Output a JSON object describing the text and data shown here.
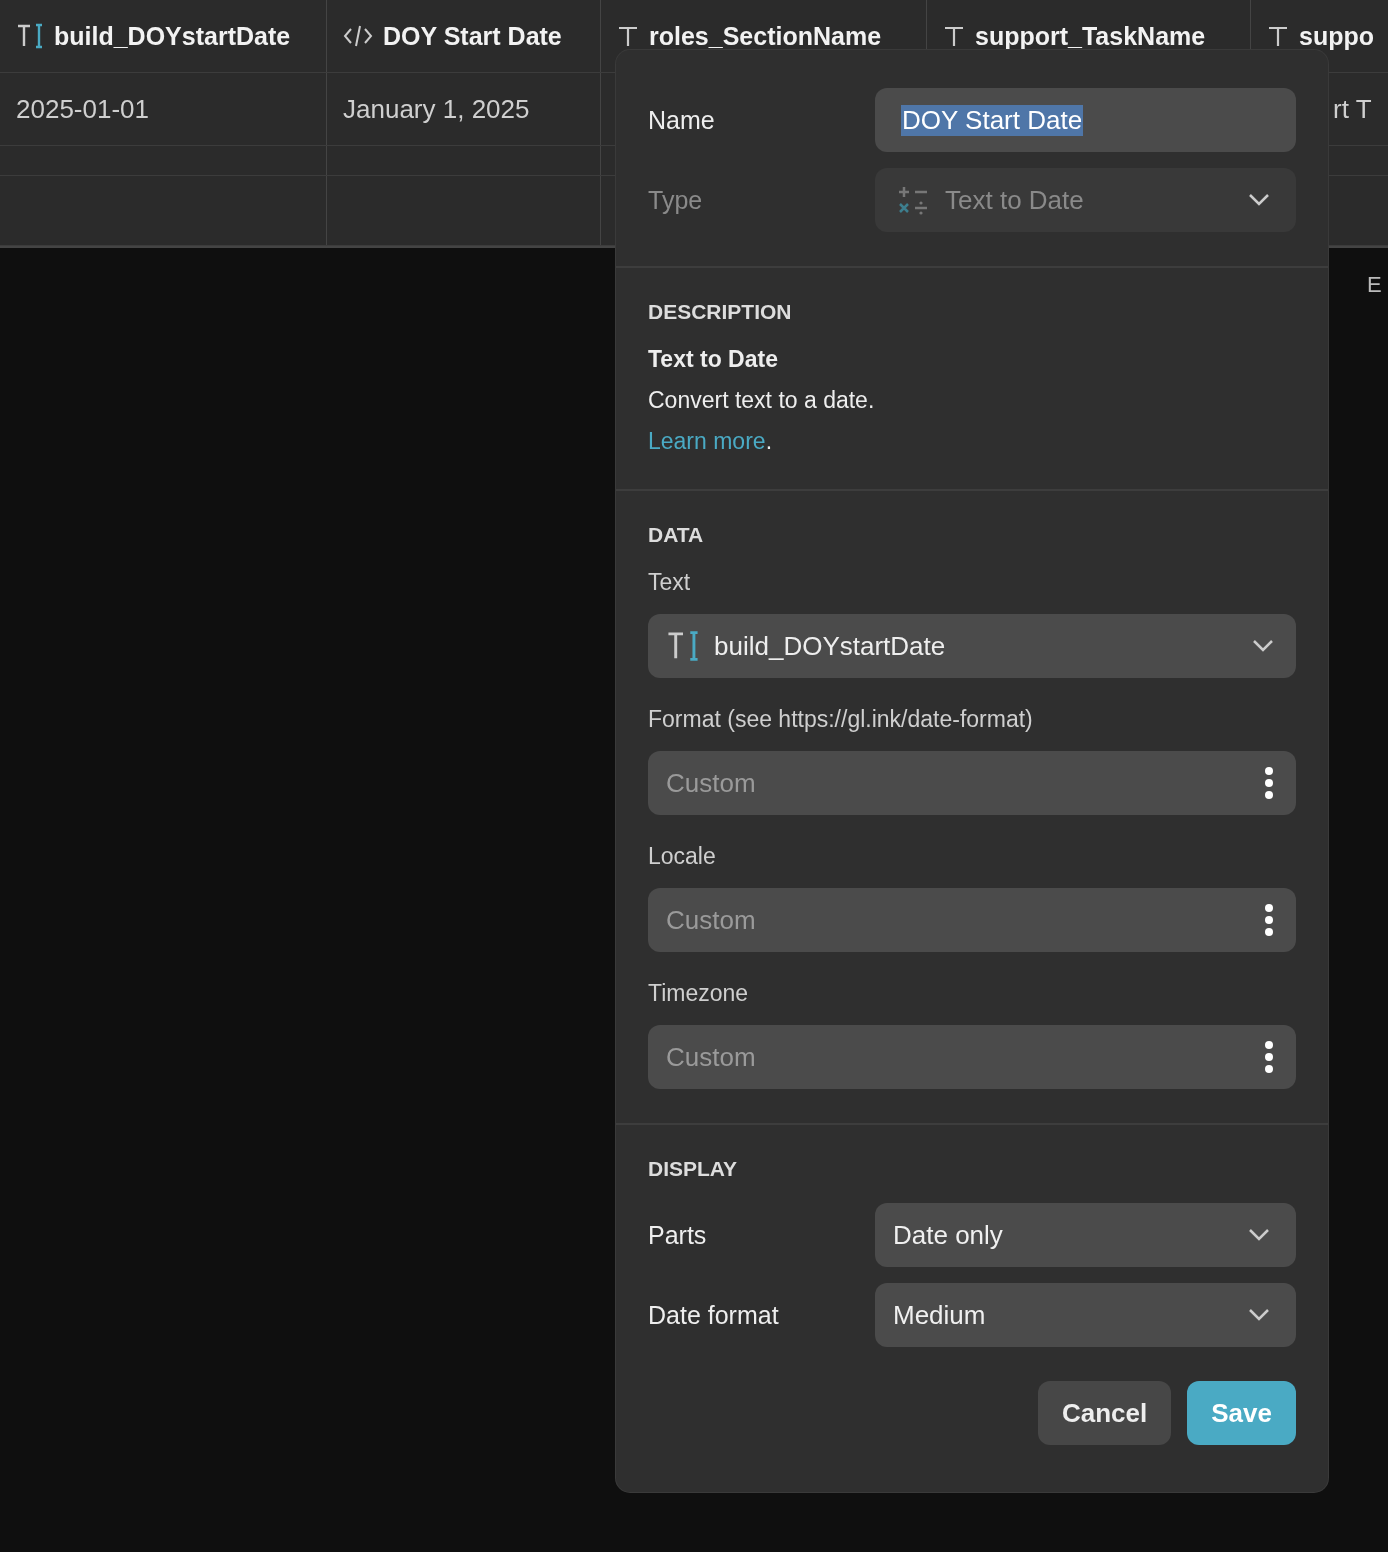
{
  "table": {
    "columns": [
      {
        "kind": "text",
        "label": "build_DOYstartDate"
      },
      {
        "kind": "code",
        "label": "DOY Start Date"
      },
      {
        "kind": "plain",
        "label": "roles_SectionName"
      },
      {
        "kind": "plain",
        "label": "support_TaskName"
      },
      {
        "kind": "plain",
        "label": "suppo"
      }
    ],
    "rows": [
      [
        "2025-01-01",
        "January 1, 2025",
        "",
        "",
        "rt T"
      ],
      [
        "",
        "",
        "",
        "",
        ""
      ],
      [
        "",
        "",
        "",
        "",
        ""
      ]
    ]
  },
  "side_text": "E",
  "dialog": {
    "name": {
      "label": "Name",
      "value": "DOY Start Date",
      "selected": true
    },
    "type": {
      "label": "Type",
      "value": "Text to Date",
      "disabled": true
    },
    "description": {
      "heading": "DESCRIPTION",
      "title": "Text to Date",
      "text": "Convert text to a date.",
      "link": "Learn more",
      "after_link": "."
    },
    "data": {
      "heading": "DATA",
      "fields": [
        {
          "kind": "column",
          "label": "Text",
          "value": "build_DOYstartDate"
        },
        {
          "kind": "custom",
          "label": "Format (see https://gl.ink/date-format)",
          "placeholder": "Custom"
        },
        {
          "kind": "custom",
          "label": "Locale",
          "placeholder": "Custom"
        },
        {
          "kind": "custom",
          "label": "Timezone",
          "placeholder": "Custom"
        }
      ]
    },
    "display": {
      "heading": "DISPLAY",
      "rows": [
        {
          "label": "Parts",
          "value": "Date only"
        },
        {
          "label": "Date format",
          "value": "Medium"
        }
      ]
    },
    "buttons": [
      {
        "kind": "secondary",
        "label": "Cancel"
      },
      {
        "kind": "primary",
        "label": "Save"
      }
    ]
  }
}
